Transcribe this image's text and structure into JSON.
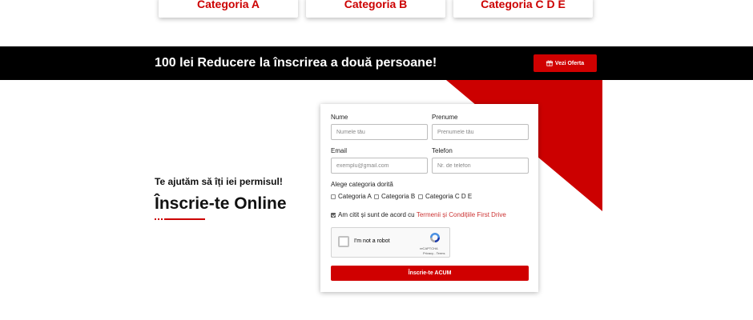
{
  "categories": [
    {
      "label": "Categoria A"
    },
    {
      "label": "Categoria B"
    },
    {
      "label": "Categoria C D E"
    }
  ],
  "promo": {
    "text": "100 lei Reducere la înscrirea a două persoane!",
    "button_label": "Vezi Oferta"
  },
  "hero": {
    "subtitle": "Te ajutăm să îți iei permisul!",
    "title": "Înscrie-te Online"
  },
  "form": {
    "nume": {
      "label": "Nume",
      "placeholder": "Numele tău"
    },
    "prenume": {
      "label": "Prenume",
      "placeholder": "Prenumele tău"
    },
    "email": {
      "label": "Email",
      "placeholder": "exemplu@gmail.com"
    },
    "telefon": {
      "label": "Telefon",
      "placeholder": "Nr. de telefon"
    },
    "category_label": "Alege categoria dorită",
    "category_options": [
      "Categoria A",
      "Categoria B",
      "Categoria C D E"
    ],
    "terms_text": "Am citit și sunt de acord cu",
    "terms_link": "Termenii și Condițiile First Drive",
    "terms_checked": true,
    "captcha": {
      "label": "I'm not a robot",
      "brand": "reCAPTCHA",
      "links": "Privacy - Terms"
    },
    "submit_label": "Înscrie-te ACUM"
  },
  "colors": {
    "accent": "#d00000",
    "promo_bg": "#000000"
  }
}
